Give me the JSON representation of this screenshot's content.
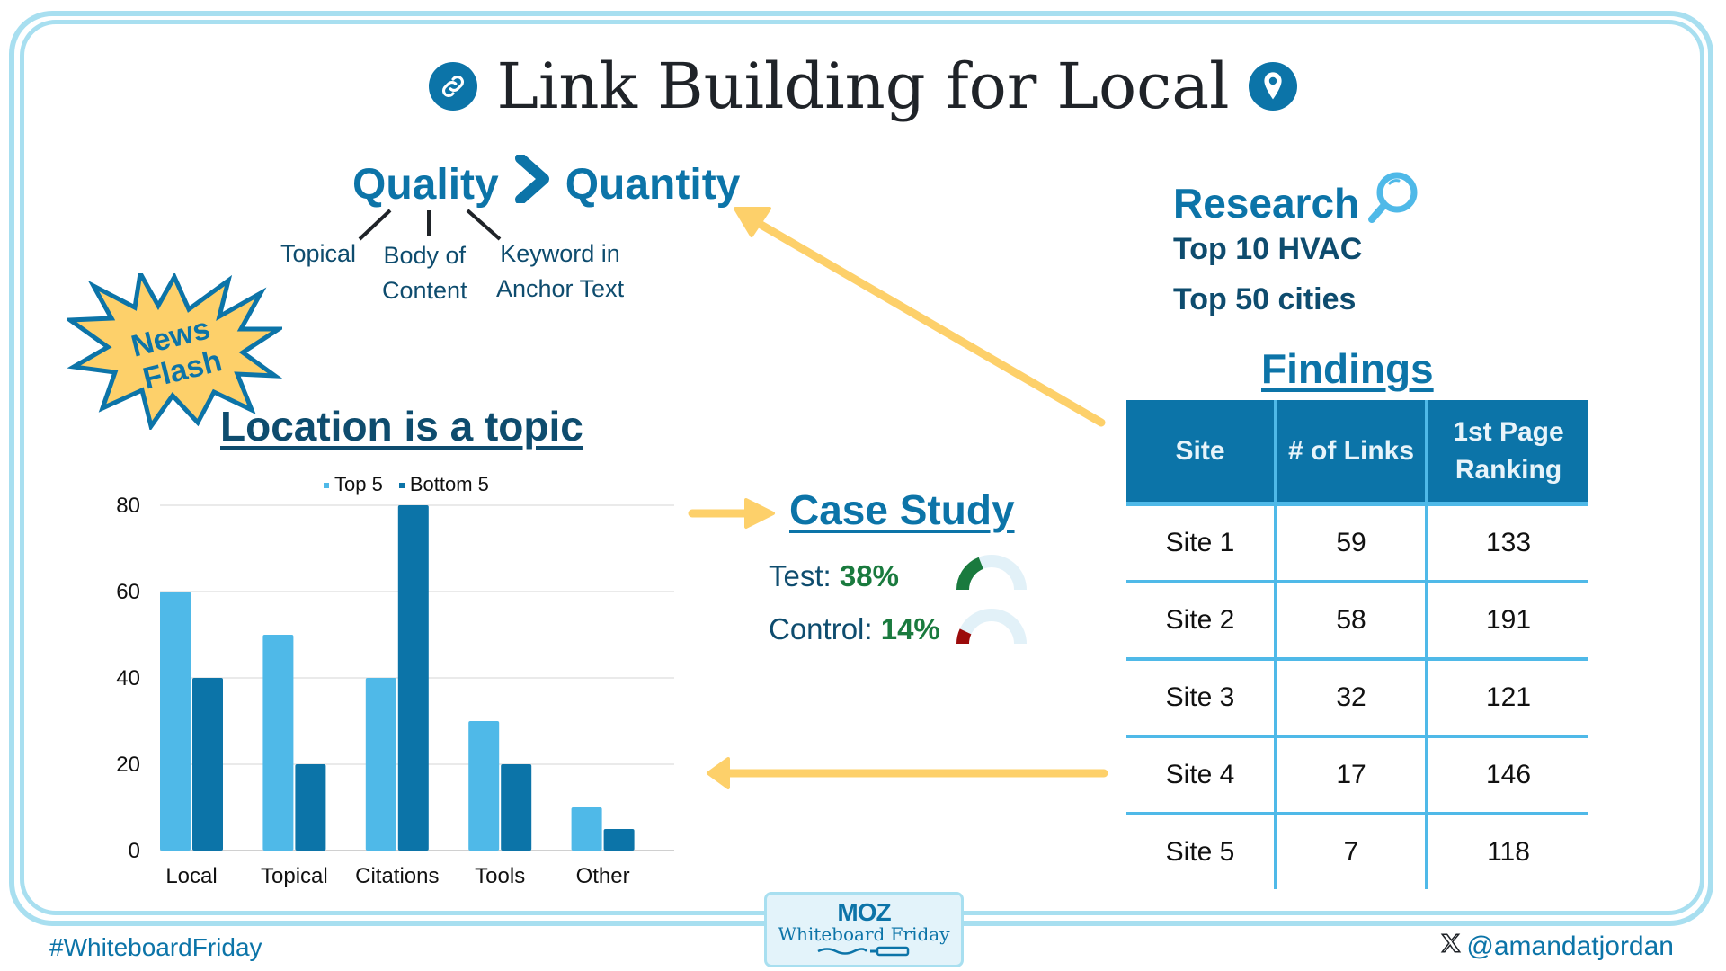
{
  "title": "Link Building for Local",
  "icons": {
    "title_left": "link-icon",
    "title_right": "location-pin-icon",
    "research": "magnifier-icon",
    "chevron": "chevron-right-icon",
    "x_logo": "x-logo-icon"
  },
  "quality": {
    "left": "Quality",
    "right": "Quantity",
    "branches": [
      {
        "lines": [
          "Topical"
        ]
      },
      {
        "lines": [
          "Body of",
          "Content"
        ]
      },
      {
        "lines": [
          "Keyword in",
          "Anchor Text"
        ]
      }
    ]
  },
  "news_flash": {
    "line1": "News",
    "line2": "Flash"
  },
  "research": {
    "heading": "Research",
    "lines": [
      "Top 10 HVAC",
      "Top 50 cities"
    ]
  },
  "findings": {
    "heading": "Findings",
    "columns": [
      "Site",
      "# of Links",
      "1st Page Ranking"
    ],
    "header_lines": {
      "col3_line1": "1st Page",
      "col3_line2": "Ranking"
    },
    "rows": [
      {
        "site": "Site 1",
        "links": "59",
        "ranking": "133"
      },
      {
        "site": "Site 2",
        "links": "58",
        "ranking": "191"
      },
      {
        "site": "Site 3",
        "links": "32",
        "ranking": "121"
      },
      {
        "site": "Site 4",
        "links": "17",
        "ranking": "146"
      },
      {
        "site": "Site 5",
        "links": "7",
        "ranking": "118"
      }
    ]
  },
  "case_study": {
    "heading": "Case Study",
    "test_label": "Test: ",
    "test_value": "38%",
    "test_fraction": 0.38,
    "control_label": "Control: ",
    "control_value": "14%",
    "control_fraction": 0.14
  },
  "colors": {
    "brand_blue": "#0c74a8",
    "light_blue": "#4fb9e8",
    "navy": "#0e4c6e",
    "accent_yellow": "#fdd06a",
    "green": "#1a7a3e",
    "red": "#9b0a0a"
  },
  "chart_data": {
    "type": "bar",
    "title": "Location is a topic",
    "categories": [
      "Local",
      "Topical",
      "Citations",
      "Tools",
      "Other"
    ],
    "series": [
      {
        "name": "Top 5",
        "color": "#4fb9e8",
        "values": [
          60,
          50,
          40,
          30,
          10
        ]
      },
      {
        "name": "Bottom 5",
        "color": "#0c74a8",
        "values": [
          40,
          20,
          80,
          20,
          5
        ]
      }
    ],
    "yticks": [
      0,
      20,
      40,
      60,
      80
    ],
    "ylim": [
      0,
      80
    ],
    "xlabel": "",
    "ylabel": "",
    "grid": true,
    "legend": "top-center"
  },
  "footer": {
    "hashtag": "#WhiteboardFriday",
    "handle": "@amandatjordan",
    "badge_logo": "MOZ",
    "badge_text": "Whiteboard Friday"
  }
}
